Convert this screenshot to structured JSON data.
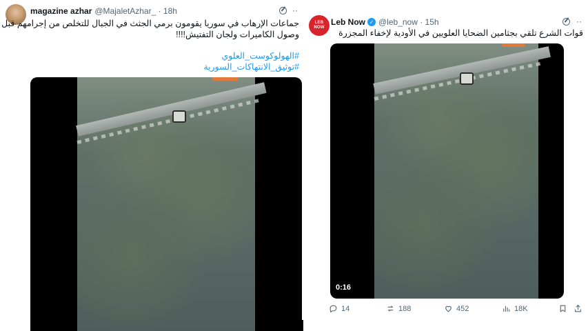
{
  "left_tweet": {
    "display_name": "magazine azhar",
    "handle_time": "@MajaletAzhar_ · 18h",
    "text_line1": "جماعات الإرهاب في سوريا يقومون برمي الجثث في الجبال للتخلص من إجرامهم قبل",
    "text_line2": "وصول الكاميرات ولجان التفتيش!!!!",
    "hashtag1": "#الهولوكوست_العلوي",
    "hashtag2": "#توثيق_الانتهاكات_السورية",
    "more": "··"
  },
  "right_tweet": {
    "display_name": "Leb Now",
    "handle_time": "@leb_now · 15h",
    "avatar_text_top": "LEB",
    "avatar_text_bottom": "NOW",
    "text": "قوات الشرع تلقي بجثامين الضحايا العلويين في الأودية لإخفاء المجزرة",
    "video_time": "0:16",
    "more": "··",
    "actions": {
      "replies": "14",
      "reposts": "188",
      "likes": "452",
      "views": "18K"
    }
  },
  "colors": {
    "link": "#1d9bf0",
    "verified": "#1d9bf0",
    "avatar_red": "#d9232d",
    "muted": "#536471"
  }
}
